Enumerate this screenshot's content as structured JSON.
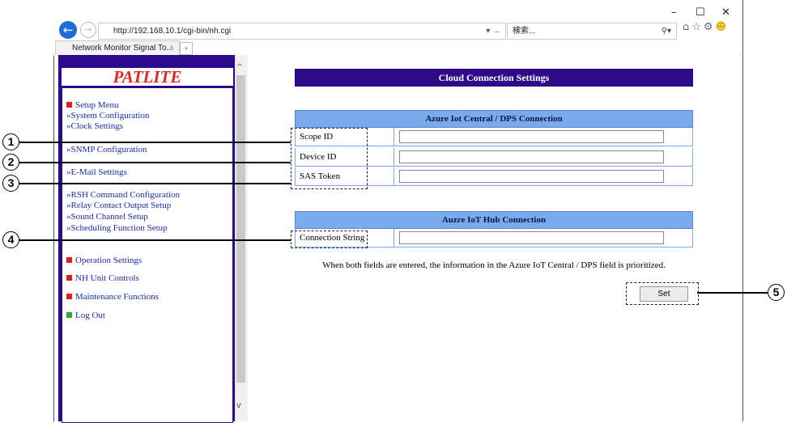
{
  "browser": {
    "url": "http://192.168.10.1/cgi-bin/nh.cgi",
    "go": "▾ →",
    "search_placeholder": "検索...",
    "tab_title": "Network Monitor Signal To...",
    "win_min": "–",
    "win_max": "☐",
    "win_close": "✕"
  },
  "sidebar": {
    "logo": "PATLITE",
    "setup_menu": "Setup Menu",
    "items": [
      "»System Configuration",
      "»Clock Settings",
      "»SNMP Configuration",
      "»E-Mail Settings",
      "»RSH Command Configuration",
      "»Relay Contact Output Setup",
      "»Sound Channel Setup",
      "»Scheduling Function Setup"
    ],
    "operation": "Operation Settings",
    "nh_unit": "NH Unit Controls",
    "maintenance": "Maintenance Functions",
    "logout": "Log Out"
  },
  "main": {
    "title": "Cloud Connection Settings",
    "section1": {
      "header": "Azure Iot Central / DPS Connection",
      "fields": [
        {
          "label": "Scope ID",
          "value": ""
        },
        {
          "label": "Device ID",
          "value": ""
        },
        {
          "label": "SAS Token",
          "value": ""
        }
      ]
    },
    "section2": {
      "header": "Auzre IoT Hub Connection",
      "fields": [
        {
          "label": "Connection String",
          "value": ""
        }
      ]
    },
    "note": "When both fields are entered, the information in the Azure IoT Central / DPS field is prioritized.",
    "set_button": "Set"
  },
  "callouts": [
    "1",
    "2",
    "3",
    "4",
    "5"
  ],
  "colors": {
    "nav": "#2d0a8a",
    "section": "#7aa9ee",
    "logo": "#e2261f"
  }
}
